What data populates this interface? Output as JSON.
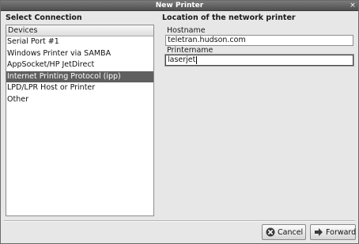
{
  "window": {
    "title": "New Printer",
    "close_glyph": "×"
  },
  "connection": {
    "title": "Select Connection",
    "list_header": "Devices",
    "devices": [
      "Serial Port #1",
      "Windows Printer via SAMBA",
      "AppSocket/HP JetDirect",
      "Internet Printing Protocol (ipp)",
      "LPD/LPR Host or Printer",
      "Other"
    ],
    "selected_index": 3
  },
  "location": {
    "title": "Location of the network printer",
    "hostname_label": "Hostname",
    "hostname_value": "teletran.hudson.com",
    "printername_label": "Printername",
    "printername_value": "laserjet"
  },
  "buttons": {
    "cancel_label": "Cancel",
    "cancel_icon": "cancel-icon",
    "forward_label": "Forward",
    "forward_icon": "forward-arrow-icon"
  }
}
